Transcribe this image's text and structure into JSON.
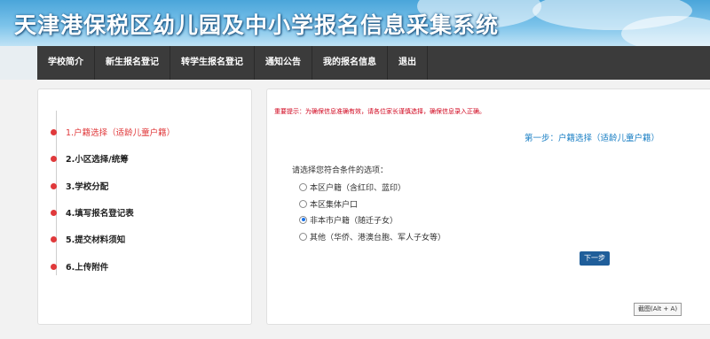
{
  "header": {
    "title": "天津港保税区幼儿园及中小学报名信息采集系统"
  },
  "nav": {
    "items": [
      "学校简介",
      "新生报名登记",
      "转学生报名登记",
      "通知公告",
      "我的报名信息",
      "退出"
    ]
  },
  "steps": {
    "items": [
      {
        "label": "1.户籍选择（适龄儿童户籍）",
        "active": true
      },
      {
        "label": "2.小区选择/统筹",
        "active": false
      },
      {
        "label": "3.学校分配",
        "active": false
      },
      {
        "label": "4.填写报名登记表",
        "active": false
      },
      {
        "label": "5.提交材料须知",
        "active": false
      },
      {
        "label": "6.上传附件",
        "active": false
      }
    ]
  },
  "main": {
    "notice": "重要提示：为确保信息准确有效，请各位家长谨慎选择，确保信息录入正确。",
    "step_heading": "第一步：户籍选择（适龄儿童户籍）",
    "prompt": "请选择您符合条件的选项：",
    "options": [
      {
        "label": "本区户籍（含红印、蓝印）",
        "checked": false
      },
      {
        "label": "本区集体户口",
        "checked": false
      },
      {
        "label": "非本市户籍（随迁子女）",
        "checked": true
      },
      {
        "label": "其他（华侨、港澳台胞、军人子女等）",
        "checked": false
      }
    ],
    "next_label": "下一步"
  },
  "tooltip": {
    "text": "截图(Alt + A)"
  },
  "colors": {
    "accent_red": "#e0393b",
    "heading_blue": "#1a7fc4",
    "nav_bg": "#3b3b3b",
    "button_bg": "#1f5e9a"
  }
}
